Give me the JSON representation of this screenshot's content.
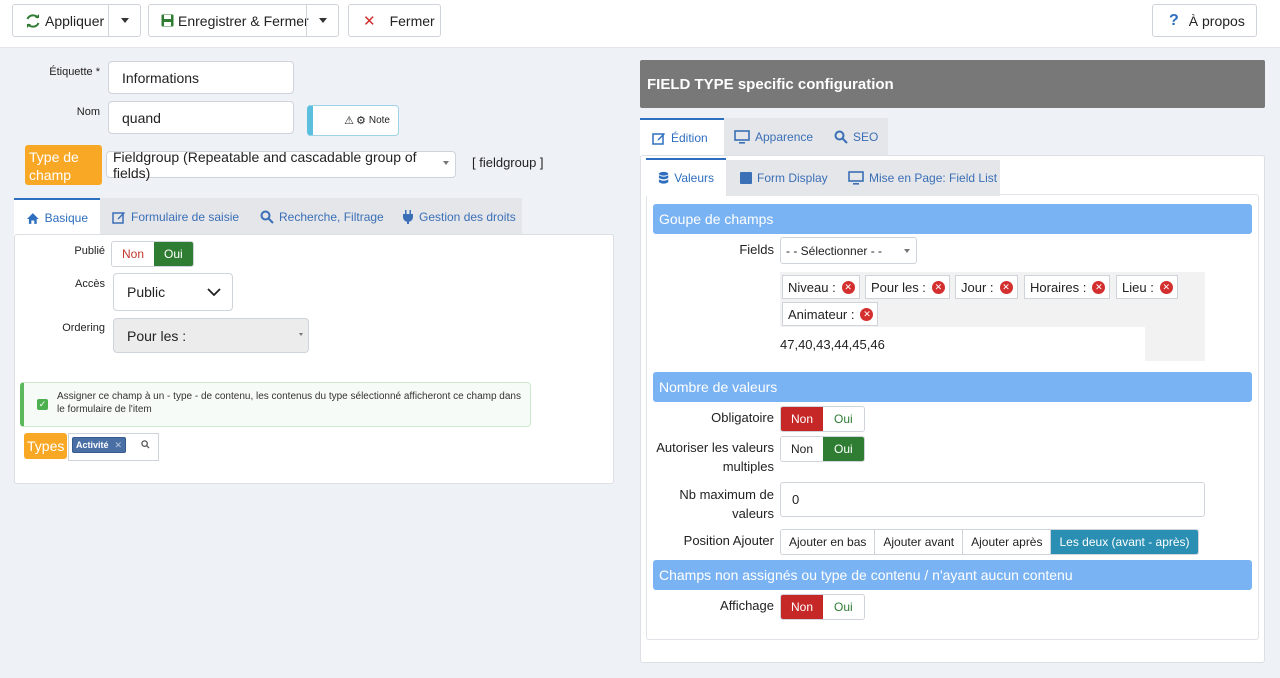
{
  "toolbar": {
    "apply": "Appliquer",
    "save_close": "Enregistrer & Fermer",
    "close": "Fermer",
    "about": "À propos"
  },
  "left": {
    "label_field": {
      "label": "Étiquette *",
      "value": "Informations"
    },
    "name_field": {
      "label": "Nom",
      "value": "quand"
    },
    "note_btn": "Note",
    "type_label": "Type de champ",
    "type_select": "Fieldgroup (Repeatable and cascadable group of fields)",
    "type_code": "[ fieldgroup ]",
    "tabs": [
      "Basique",
      "Formulaire de saisie",
      "Recherche, Filtrage",
      "Gestion des droits"
    ],
    "published": {
      "label": "Publié",
      "non": "Non",
      "oui": "Oui"
    },
    "access": {
      "label": "Accès",
      "value": "Public"
    },
    "ordering": {
      "label": "Ordering",
      "value": "Pour les :"
    },
    "assign_text": "Assigner ce champ à un - type - de contenu, les contenus du type sélectionné afficheront ce champ dans le formulaire de l'item",
    "types_label": "Types",
    "types_tag": "Activité"
  },
  "right": {
    "header": "FIELD TYPE specific configuration",
    "tabs": [
      "Édition",
      "Apparence",
      "SEO"
    ],
    "subtabs": [
      "Valeurs",
      "Form Display",
      "Mise en Page: Field List"
    ],
    "group_section": "Goupe de champs",
    "fields_label": "Fields",
    "fields_select": "- - Sélectionner - -",
    "chips": [
      "Niveau :",
      "Pour les :",
      "Jour :",
      "Horaires :",
      "Lieu :",
      "Animateur :"
    ],
    "ids_value": "47,40,43,44,45,46",
    "values_section": "Nombre de valeurs",
    "required": {
      "label": "Obligatoire",
      "non": "Non",
      "oui": "Oui"
    },
    "multiple": {
      "label": "Autoriser les valeurs multiples",
      "non": "Non",
      "oui": "Oui"
    },
    "max_values": {
      "label": "Nb maximum de valeurs",
      "value": "0"
    },
    "position": {
      "label": "Position Ajouter",
      "options": [
        "Ajouter en bas",
        "Ajouter avant",
        "Ajouter après",
        "Les deux (avant - après)"
      ]
    },
    "unassigned_section": "Champs non assignés ou type de contenu / n'ayant aucun contenu",
    "display": {
      "label": "Affichage",
      "non": "Non",
      "oui": "Oui"
    }
  },
  "colors": {
    "accent": "#2e6ebf",
    "section": "#7ab3f3",
    "orange": "#f9a825",
    "red": "#c62828",
    "green": "#2e7d32",
    "teal": "#2a8fb3"
  }
}
